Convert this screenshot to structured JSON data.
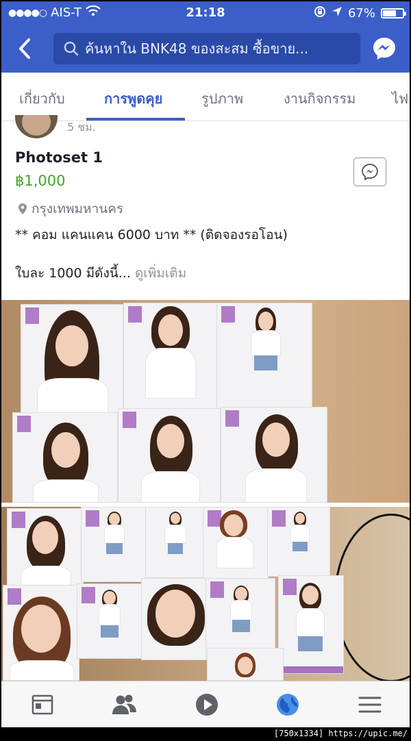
{
  "status_bar": {
    "carrier": "AIS-T",
    "time": "21:18",
    "battery": "67%",
    "battery_level": 0.67
  },
  "nav": {
    "search_text": "ค้นหาใน BNK48 ของสะสม ซื้อขาย..."
  },
  "tabs": [
    {
      "label": "เกี่ยวกับ"
    },
    {
      "label": "การพูดคุย"
    },
    {
      "label": "รูปภาพ"
    },
    {
      "label": "งานกิจกรรม"
    },
    {
      "label": "ไฟ"
    }
  ],
  "post": {
    "time_ago": "5 ชม.",
    "title": "Photoset 1",
    "price": "฿1,000",
    "location": "กรุงเทพมหานคร",
    "description_line1": "** คอม แคนแคน 6000 บาท ** (ติดจองรอโอน)",
    "description_line2": "ใบละ 1000 มีดังนี้...",
    "see_more": "ดูเพิ่มเติม"
  },
  "watermark": "[750x1334] https://upic.me/",
  "colors": {
    "brand_blue": "#3b5ec8",
    "price_green": "#42a52a",
    "muted_gray": "#90949c"
  },
  "icons": {
    "back": "chevron-left-icon",
    "search": "search-icon",
    "messenger": "messenger-icon",
    "location": "location-pin-icon",
    "bottom_bar": [
      "news-feed-icon",
      "friends-icon",
      "video-play-icon",
      "globe-icon",
      "menu-icon"
    ]
  }
}
